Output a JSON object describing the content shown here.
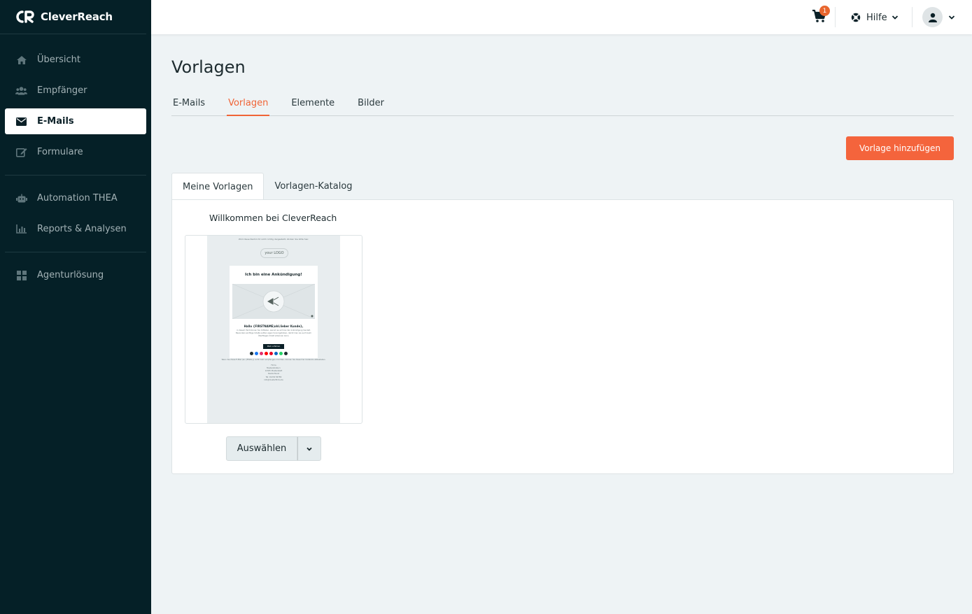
{
  "brand": {
    "name": "CleverReach"
  },
  "sidebar": {
    "items": [
      {
        "label": "Übersicht",
        "icon": "home-icon"
      },
      {
        "label": "Empfänger",
        "icon": "users-icon"
      },
      {
        "label": "E-Mails",
        "icon": "envelope-icon",
        "active": true
      },
      {
        "label": "Formulare",
        "icon": "edit-icon"
      },
      {
        "label": "Automation THEA",
        "icon": "robot-icon"
      },
      {
        "label": "Reports & Analysen",
        "icon": "bar-chart-icon"
      },
      {
        "label": "Agenturlösung",
        "icon": "grid-icon"
      }
    ]
  },
  "topbar": {
    "cart_count": "1",
    "help_label": "Hilfe"
  },
  "page": {
    "title": "Vorlagen",
    "tabs": [
      {
        "label": "E-Mails"
      },
      {
        "label": "Vorlagen",
        "active": true
      },
      {
        "label": "Elemente"
      },
      {
        "label": "Bilder"
      }
    ],
    "add_button": "Vorlage hinzufügen",
    "subtabs": [
      {
        "label": "Meine Vorlagen",
        "active": true
      },
      {
        "label": "Vorlagen-Katalog"
      }
    ],
    "template": {
      "title": "Willkommen bei CleverReach",
      "preview": {
        "top_note": "Wird diese Nachricht nicht richtig dargestellt, klicken Sie bitte hier.",
        "logo": "your LOGO",
        "heading": "Ich bin eine Ankündigung!",
        "greeting": "Hallo {FIRSTNAME|ohl.lieber Kunde},",
        "body": "in diesem Text können Sie mitteilen, warum es sich bei der Ankündigung handelt. Besonders wichtige Inhalte sollten eigen hervorgehoben, damit man sie auch beim Überfliegen direkt erkennen kann.",
        "button": "Mehr erfahren",
        "footer_note": "Wenn Sie diese E-Mail (an {EMAIL}) nicht mehr empfangen möchten, können Sie diese hier kostenlos abbestellen.",
        "address": [
          "Firma",
          "Musterstraße 1",
          "12345 Musterstadt",
          "Deutschland",
          "Tel: 01234 56789",
          "info@musterfirma.de"
        ]
      },
      "select_label": "Auswählen"
    }
  },
  "colors": {
    "sidebar_bg": "#052027",
    "accent": "#f4643c",
    "page_bg": "#eef3f5"
  }
}
